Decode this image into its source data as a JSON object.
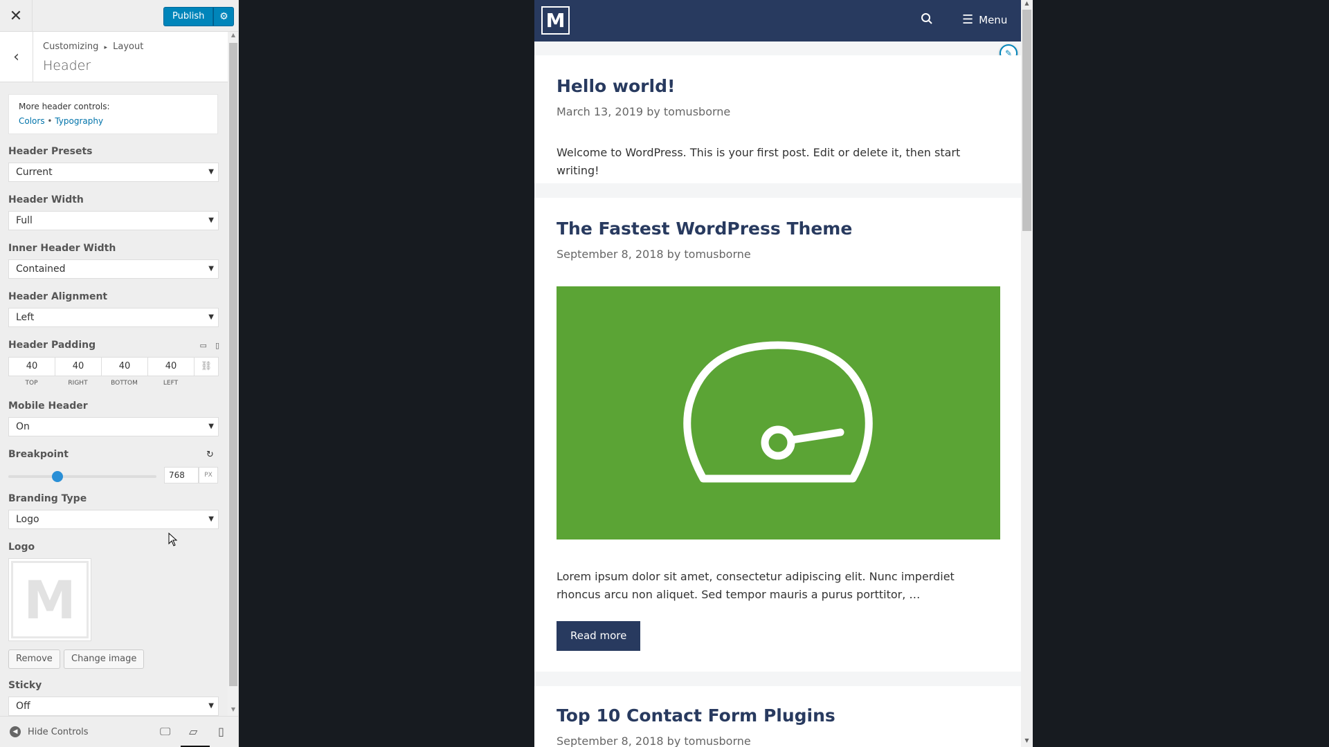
{
  "topbar": {
    "close": "✕",
    "publish_label": "Publish",
    "gear": "⚙"
  },
  "section": {
    "back": "‹",
    "breadcrumb_root": "Customizing",
    "breadcrumb_sep": "▸",
    "breadcrumb_parent": "Layout",
    "title": "Header"
  },
  "more_controls": {
    "title": "More header controls:",
    "link_colors": "Colors",
    "link_sep": "•",
    "link_typography": "Typography"
  },
  "fields": {
    "header_presets": {
      "label": "Header Presets",
      "value": "Current"
    },
    "header_width": {
      "label": "Header Width",
      "value": "Full"
    },
    "inner_header_width": {
      "label": "Inner Header Width",
      "value": "Contained"
    },
    "header_alignment": {
      "label": "Header Alignment",
      "value": "Left"
    },
    "header_padding": {
      "label": "Header Padding",
      "top": "40",
      "right": "40",
      "bottom": "40",
      "left": "40",
      "top_label": "TOP",
      "right_label": "RIGHT",
      "bottom_label": "BOTTOM",
      "left_label": "LEFT"
    },
    "mobile_header": {
      "label": "Mobile Header",
      "value": "On"
    },
    "breakpoint": {
      "label": "Breakpoint",
      "value": "768",
      "unit": "PX",
      "slider_fraction": 0.33
    },
    "branding_type": {
      "label": "Branding Type",
      "value": "Logo"
    },
    "logo": {
      "label": "Logo",
      "letter": "M",
      "remove_label": "Remove",
      "change_label": "Change image"
    },
    "sticky": {
      "label": "Sticky",
      "value": "Off"
    }
  },
  "footer": {
    "hide_controls": "Hide Controls"
  },
  "site": {
    "logo_letter": "M",
    "menu_label": "Menu",
    "posts": [
      {
        "title": "Hello world!",
        "meta": "March 13, 2019 by tomusborne",
        "excerpt": "Welcome to WordPress. This is your first post. Edit or delete it, then start writing!"
      },
      {
        "title": "The Fastest WordPress Theme",
        "meta": "September 8, 2018 by tomusborne",
        "excerpt": "Lorem ipsum dolor sit amet, consectetur adipiscing elit. Nunc imperdiet rhoncus arcu non aliquet. Sed tempor mauris a purus porttitor, …",
        "read_more": "Read more"
      },
      {
        "title": "Top 10 Contact Form Plugins",
        "meta": "September 8, 2018 by tomusborne"
      }
    ]
  },
  "colors": {
    "primary": "#0085ba",
    "site_header": "#283a5f",
    "image_green": "#5ba435",
    "background": "#171b20"
  }
}
